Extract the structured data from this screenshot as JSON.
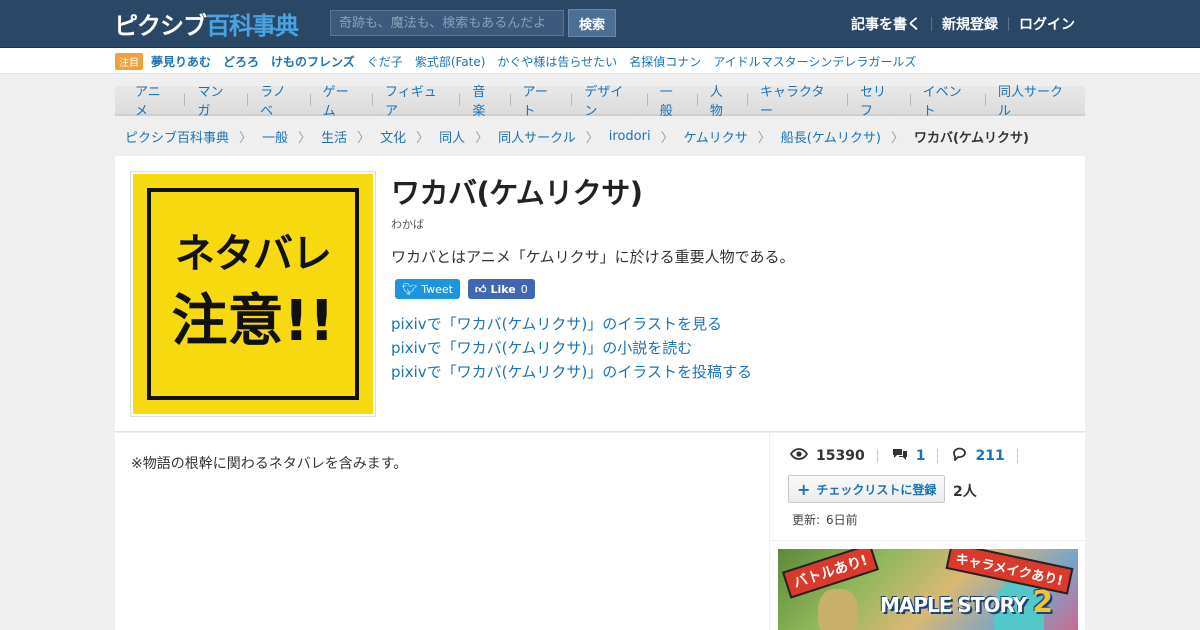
{
  "header": {
    "logo_part1": "ピクシブ",
    "logo_part2": "百科事典",
    "search_placeholder": "奇跡も、魔法も、検索もあるんだよ",
    "search_button": "検索",
    "nav": [
      "記事を書く",
      "新規登録",
      "ログイン"
    ]
  },
  "trending": {
    "badge": "注目",
    "items": [
      {
        "label": "夢見りあむ",
        "bold": true
      },
      {
        "label": "どろろ",
        "bold": true
      },
      {
        "label": "けものフレンズ",
        "bold": true
      },
      {
        "label": "ぐだ子",
        "bold": false
      },
      {
        "label": "紫式部(Fate)",
        "bold": false
      },
      {
        "label": "かぐや様は告らせたい",
        "bold": false
      },
      {
        "label": "名探偵コナン",
        "bold": false
      },
      {
        "label": "アイドルマスターシンデレラガールズ",
        "bold": false
      }
    ]
  },
  "categories": [
    "アニメ",
    "マンガ",
    "ラノベ",
    "ゲーム",
    "フィギュア",
    "音楽",
    "アート",
    "デザイン",
    "一般",
    "人物",
    "キャラクター",
    "セリフ",
    "イベント",
    "同人サークル"
  ],
  "breadcrumb": [
    "ピクシブ百科事典",
    "一般",
    "生活",
    "文化",
    "同人",
    "同人サークル",
    "irodori",
    "ケムリクサ",
    "船長(ケムリクサ)",
    "ワカバ(ケムリクサ)"
  ],
  "article": {
    "thumbnail_line1": "ネタバレ",
    "thumbnail_line2": "注意!!",
    "title": "ワカバ(ケムリクサ)",
    "reading": "わかば",
    "summary": "ワカバとはアニメ「ケムリクサ」に於ける重要人物である。",
    "tweet_label": "Tweet",
    "like_label": "Like",
    "like_count": "0",
    "pixiv_links": [
      "pixivで「ワカバ(ケムリクサ)」のイラストを見る",
      "pixivで「ワカバ(ケムリクサ)」の小説を読む",
      "pixivで「ワカバ(ケムリクサ)」のイラストを投稿する"
    ],
    "body_note": "※物語の根幹に関わるネタバレを含みます。"
  },
  "sidebar": {
    "views": "15390",
    "comments": "1",
    "edits": "211",
    "checklist_button": "チェックリストに登録",
    "checklist_count": "2人",
    "updated_label": "更新:",
    "updated_value": "6日前"
  },
  "ad": {
    "tag_left": "バトルあり!",
    "tag_right": "キャラメイクあり!",
    "logo_text": "MAPLE STORY",
    "logo_num": "2"
  },
  "colors": {
    "header_bg": "#2b4766",
    "link": "#1a73b8",
    "thumbnail_bg": "#f6d90f",
    "badge": "#f0a03c"
  }
}
